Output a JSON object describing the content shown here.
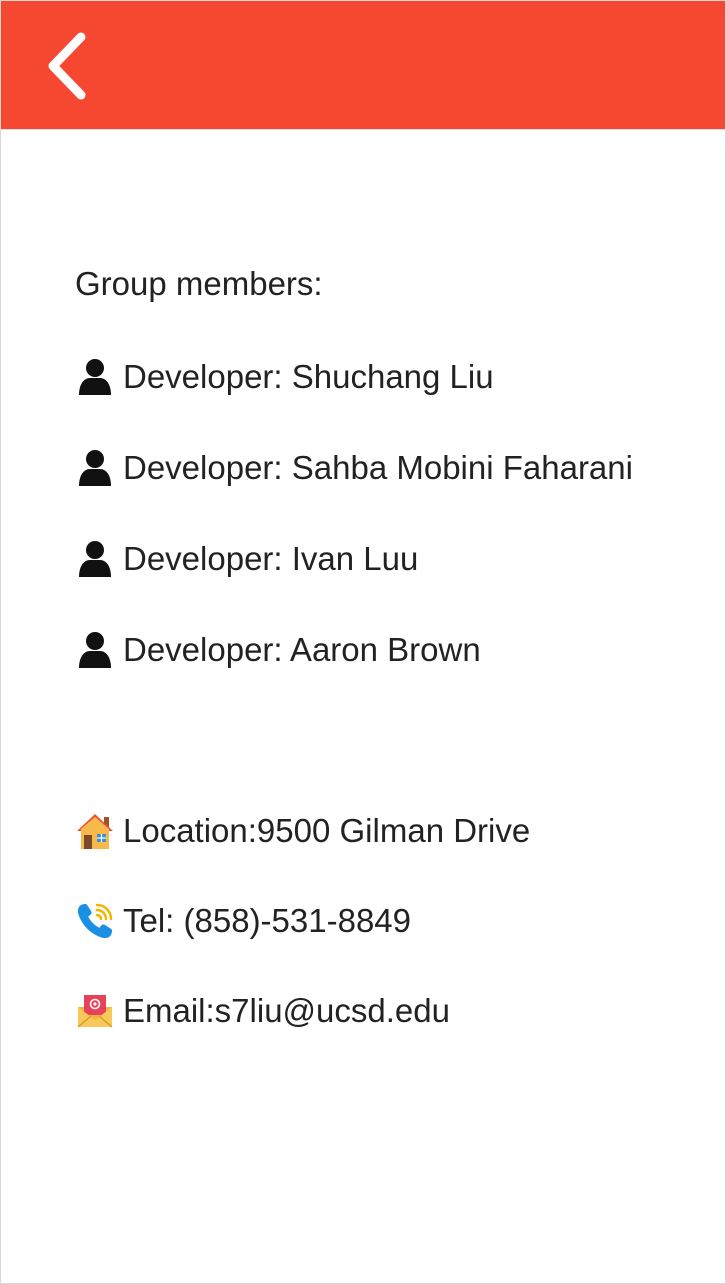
{
  "header": {
    "back_icon": "chevron-left-icon",
    "background_color": "#f64831"
  },
  "group": {
    "title": "Group members:",
    "members": [
      {
        "icon": "user-icon",
        "label": "Developer: Shuchang Liu"
      },
      {
        "icon": "user-icon",
        "label": "Developer: Sahba Mobini Faharani"
      },
      {
        "icon": "user-icon",
        "label": "Developer: Ivan Luu"
      },
      {
        "icon": "user-icon",
        "label": "Developer: Aaron Brown"
      }
    ]
  },
  "contact": {
    "location": {
      "icon": "house-icon",
      "label": "Location:9500 Gilman Drive"
    },
    "tel": {
      "icon": "phone-icon",
      "label": "Tel: (858)-531-8849"
    },
    "email": {
      "icon": "email-icon",
      "label": "Email:s7liu@ucsd.edu"
    }
  }
}
